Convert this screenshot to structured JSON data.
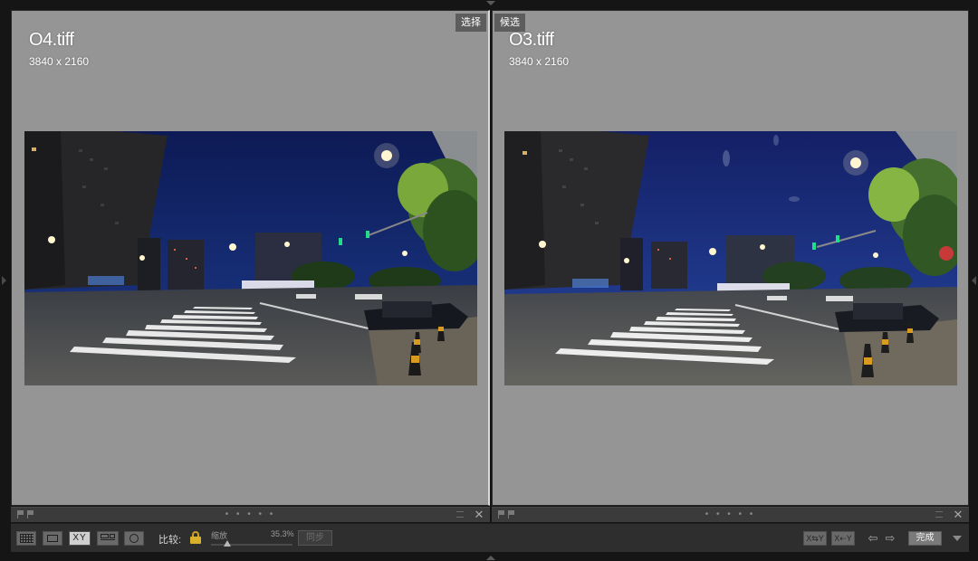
{
  "left_pane": {
    "filename": "O4.tiff",
    "dimensions": "3840 x 2160",
    "tag": "选择"
  },
  "right_pane": {
    "filename": "O3.tiff",
    "dimensions": "3840 x 2160",
    "tag": "候选"
  },
  "strips": {
    "dots": "• • • • •",
    "close_glyph": "✕"
  },
  "toolbar": {
    "xy_label": "XY",
    "compare_label": "比较:",
    "zoom_label": "缩放",
    "zoom_value": "35.3%",
    "zoom_fraction": 0.2,
    "sync_label": "同步",
    "swap_label": "X⇆Y",
    "make_select_label": "X⇠Y",
    "prev_glyph": "⇦",
    "next_glyph": "⇨",
    "done_label": "完成"
  },
  "icons": [
    "grid-view-icon",
    "loupe-view-icon",
    "compare-view-icon",
    "survey-view-icon",
    "people-view-icon",
    "lock-icon",
    "flag-icon",
    "close-icon",
    "arrow-left-icon",
    "arrow-right-icon",
    "chevron-down-icon"
  ],
  "colors": {
    "pane_background": "#959595",
    "toolbar_background": "#2e2e2e",
    "lock_gold": "#d9b02c"
  }
}
